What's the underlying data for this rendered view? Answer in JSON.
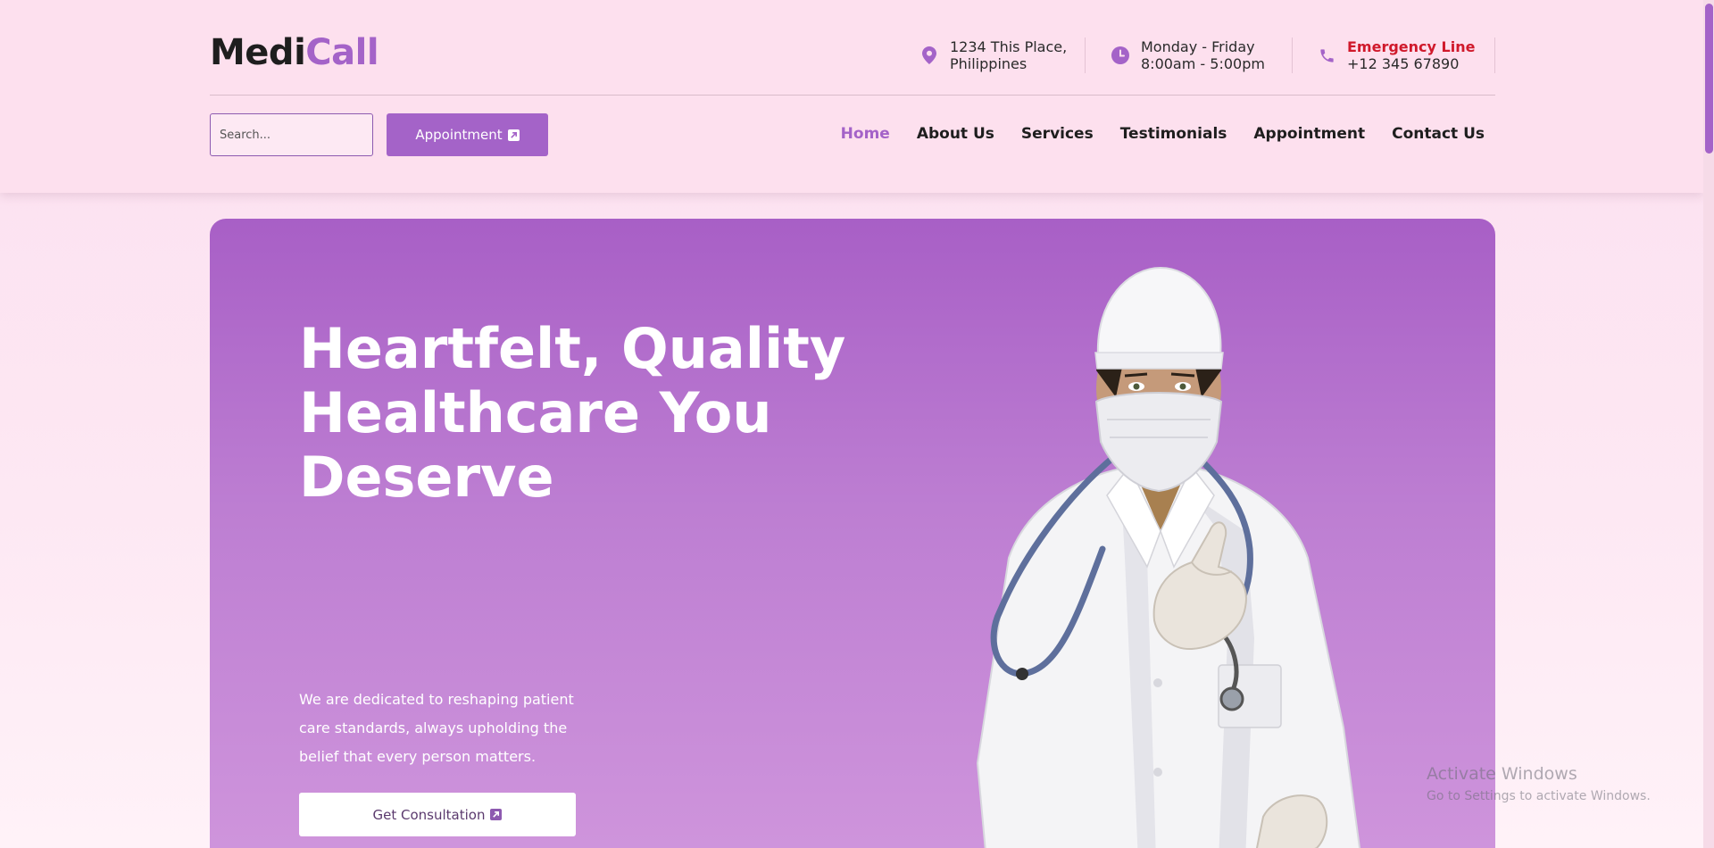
{
  "brand": {
    "part1": "Medi",
    "part2": "Call"
  },
  "topinfo": {
    "address": {
      "line1": "1234 This Place,",
      "line2": "Philippines"
    },
    "hours": {
      "line1": "Monday - Friday",
      "line2": "8:00am - 5:00pm"
    },
    "emergency": {
      "label": "Emergency Line",
      "phone": "+12 345 67890"
    }
  },
  "search": {
    "placeholder": "Search..."
  },
  "appointment_button": {
    "label": "Appointment"
  },
  "nav": {
    "items": [
      {
        "label": "Home",
        "active": true
      },
      {
        "label": "About Us"
      },
      {
        "label": "Services"
      },
      {
        "label": "Testimonials"
      },
      {
        "label": "Appointment"
      },
      {
        "label": "Contact Us"
      }
    ]
  },
  "hero": {
    "title_lines": [
      "Heartfelt, Quality",
      "Healthcare You",
      "Deserve"
    ],
    "subtitle_lines": [
      "We are dedicated to reshaping patient",
      "care standards, always upholding the",
      "belief that every person matters."
    ],
    "cta_label": "Get Consultation"
  },
  "watermark": {
    "line1": "Activate Windows",
    "line2": "Go to Settings to activate Windows."
  },
  "colors": {
    "accent": "#a463c8",
    "emergency": "#d0192b",
    "header_bg": "#fde0ee"
  },
  "icons": [
    "location-pin-icon",
    "clock-icon",
    "phone-icon",
    "external-arrow-icon"
  ]
}
